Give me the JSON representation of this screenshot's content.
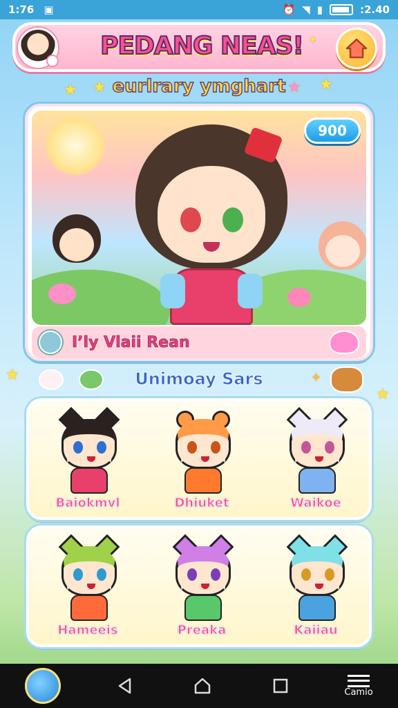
{
  "status": {
    "time": "1:76",
    "right_time": ":2.40"
  },
  "header": {
    "title": "PEDANG NEAS!"
  },
  "subtitle": "eurlrary ymghart",
  "hero": {
    "counter": "900",
    "name": "I’ly Vlaii Rean"
  },
  "section": {
    "title": "Unimoay Sars"
  },
  "roster": {
    "row1": [
      {
        "name": "Baiokmvl",
        "hair": "#2b2220",
        "outfit": "#e8406a",
        "eyes": "#2f6fd1"
      },
      {
        "name": "Dhiuket",
        "hair": "#ff9a47",
        "outfit": "#ff7a2e",
        "eyes": "#c8541a"
      },
      {
        "name": "Waikoe",
        "hair": "#eeeaf8",
        "outfit": "#7fb2f0",
        "eyes": "#c3559a"
      }
    ],
    "row2": [
      {
        "name": "Hameeis",
        "hair": "#9fd24a",
        "outfit": "#ff6a3a",
        "eyes": "#2e9bcf"
      },
      {
        "name": "Preaka",
        "hair": "#cf7fe6",
        "outfit": "#58c86a",
        "eyes": "#7a3fb8"
      },
      {
        "name": "Kaiiau",
        "hair": "#7fe0e8",
        "outfit": "#4aa2e0",
        "eyes": "#d99a25"
      }
    ]
  },
  "navbar": {
    "menu_label": "Camio"
  },
  "colors": {
    "accent_pink": "#ff4f8f",
    "accent_blue": "#3aa3d8",
    "gold": "#ffd93b"
  }
}
